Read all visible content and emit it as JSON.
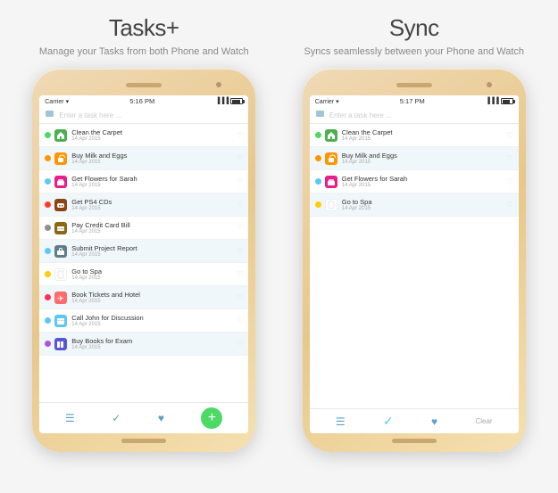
{
  "left_column": {
    "title": "Tasks+",
    "subtitle": "Manage your Tasks from both Phone and Watch",
    "phone": {
      "status_bar": {
        "carrier": "Carrier ▾",
        "time": "5:16 PM"
      },
      "search_placeholder": "Enter a task here ...",
      "tasks": [
        {
          "dot_color": "#4cd964",
          "icon_bg": "#4caf50",
          "icon": "🏠",
          "name": "Clean the Carpet",
          "date": "14 Apr 2015",
          "highlighted": false
        },
        {
          "dot_color": "#ff9500",
          "icon_bg": "#ff9500",
          "icon": "👜",
          "name": "Buy Milk and Eggs",
          "date": "14 Apr 2015",
          "highlighted": true
        },
        {
          "dot_color": "#5ac8fa",
          "icon_bg": "#e91e8c",
          "icon": "🎁",
          "name": "Get Flowers for Sarah",
          "date": "14 Apr 2015",
          "highlighted": false
        },
        {
          "dot_color": "#ff3b30",
          "icon_bg": "#8b4513",
          "icon": "🎮",
          "name": "Get PS4 CDs",
          "date": "14 Apr 2015",
          "highlighted": true
        },
        {
          "dot_color": "#8e8e93",
          "icon_bg": "#8b6914",
          "icon": "💳",
          "name": "Pay Credit Card Bill",
          "date": "14 Apr 2015",
          "highlighted": false
        },
        {
          "dot_color": "#5ac8fa",
          "icon_bg": "#607d8b",
          "icon": "💼",
          "name": "Submit Project Report",
          "date": "14 Apr 2015",
          "highlighted": true
        },
        {
          "dot_color": "#ffcc00",
          "icon_bg": "#ffffff",
          "icon": "📄",
          "name": "Go to Spa",
          "date": "14 Apr 2015",
          "highlighted": false
        },
        {
          "dot_color": "#ff2d55",
          "icon_bg": "#ff6b6b",
          "icon": "✈",
          "name": "Book Tickets and Hotel",
          "date": "14 Apr 2015",
          "highlighted": true
        },
        {
          "dot_color": "#5ac8fa",
          "icon_bg": "#5ac8fa",
          "icon": "📅",
          "name": "Call John for Discussion",
          "date": "14 Apr 2015",
          "highlighted": false
        },
        {
          "dot_color": "#af52de",
          "icon_bg": "#5856d6",
          "icon": "📚",
          "name": "Buy Books for Exam",
          "date": "14 Apr 2015",
          "highlighted": true
        }
      ],
      "toolbar": {
        "icon1": "☰",
        "icon2": "✓",
        "icon3": "♥",
        "add": "+"
      }
    }
  },
  "right_column": {
    "title": "Sync",
    "subtitle": "Syncs seamlessly between your Phone and Watch",
    "phone": {
      "status_bar": {
        "carrier": "Carrier ▾",
        "time": "5:17 PM"
      },
      "search_placeholder": "Enter a task here ...",
      "tasks": [
        {
          "dot_color": "#4cd964",
          "icon_bg": "#4caf50",
          "icon": "🏠",
          "name": "Clean the Carpet",
          "date": "14 Apr 2015",
          "highlighted": false
        },
        {
          "dot_color": "#ff9500",
          "icon_bg": "#ff9500",
          "icon": "👜",
          "name": "Buy Milk and Eggs",
          "date": "14 Apr 2015",
          "highlighted": true
        },
        {
          "dot_color": "#5ac8fa",
          "icon_bg": "#e91e8c",
          "icon": "🎁",
          "name": "Get Flowers for Sarah",
          "date": "14 Apr 2015",
          "highlighted": false
        },
        {
          "dot_color": "#ffcc00",
          "icon_bg": "#ffffff",
          "icon": "📄",
          "name": "Go to Spa",
          "date": "14 Apr 2015",
          "highlighted": true
        }
      ],
      "toolbar": {
        "icon1": "☰",
        "icon2": "✓",
        "icon3": "♥",
        "clear": "Clear"
      }
    }
  }
}
